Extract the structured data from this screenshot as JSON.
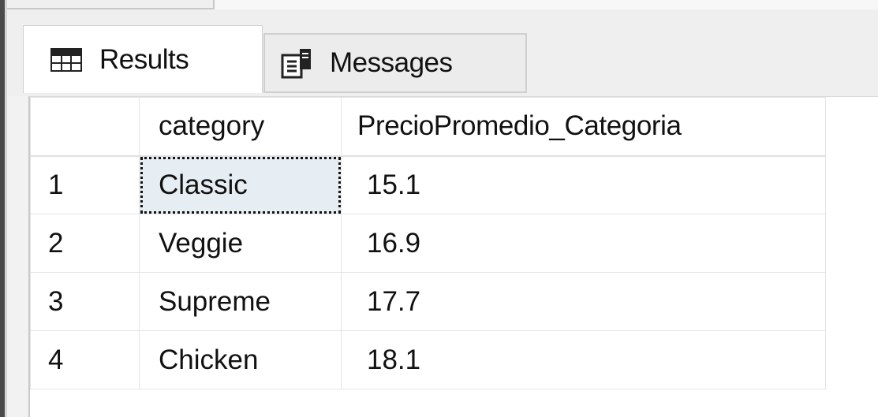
{
  "tabs": {
    "results_label": "Results",
    "messages_label": "Messages",
    "results_icon": "grid-icon",
    "messages_icon": "messages-icon"
  },
  "grid": {
    "columns": [
      "",
      "category",
      "PrecioPromedio_Categoria"
    ],
    "rows": [
      {
        "num": "1",
        "category": "Classic",
        "price": "15.1"
      },
      {
        "num": "2",
        "category": "Veggie",
        "price": "16.9"
      },
      {
        "num": "3",
        "category": "Supreme",
        "price": "17.7"
      },
      {
        "num": "4",
        "category": "Chicken",
        "price": "18.1"
      }
    ]
  },
  "colors": {
    "selected_cell": "#e6edf3",
    "grid_line": "#e4e4e4",
    "window_border": "#4a4a4a"
  }
}
